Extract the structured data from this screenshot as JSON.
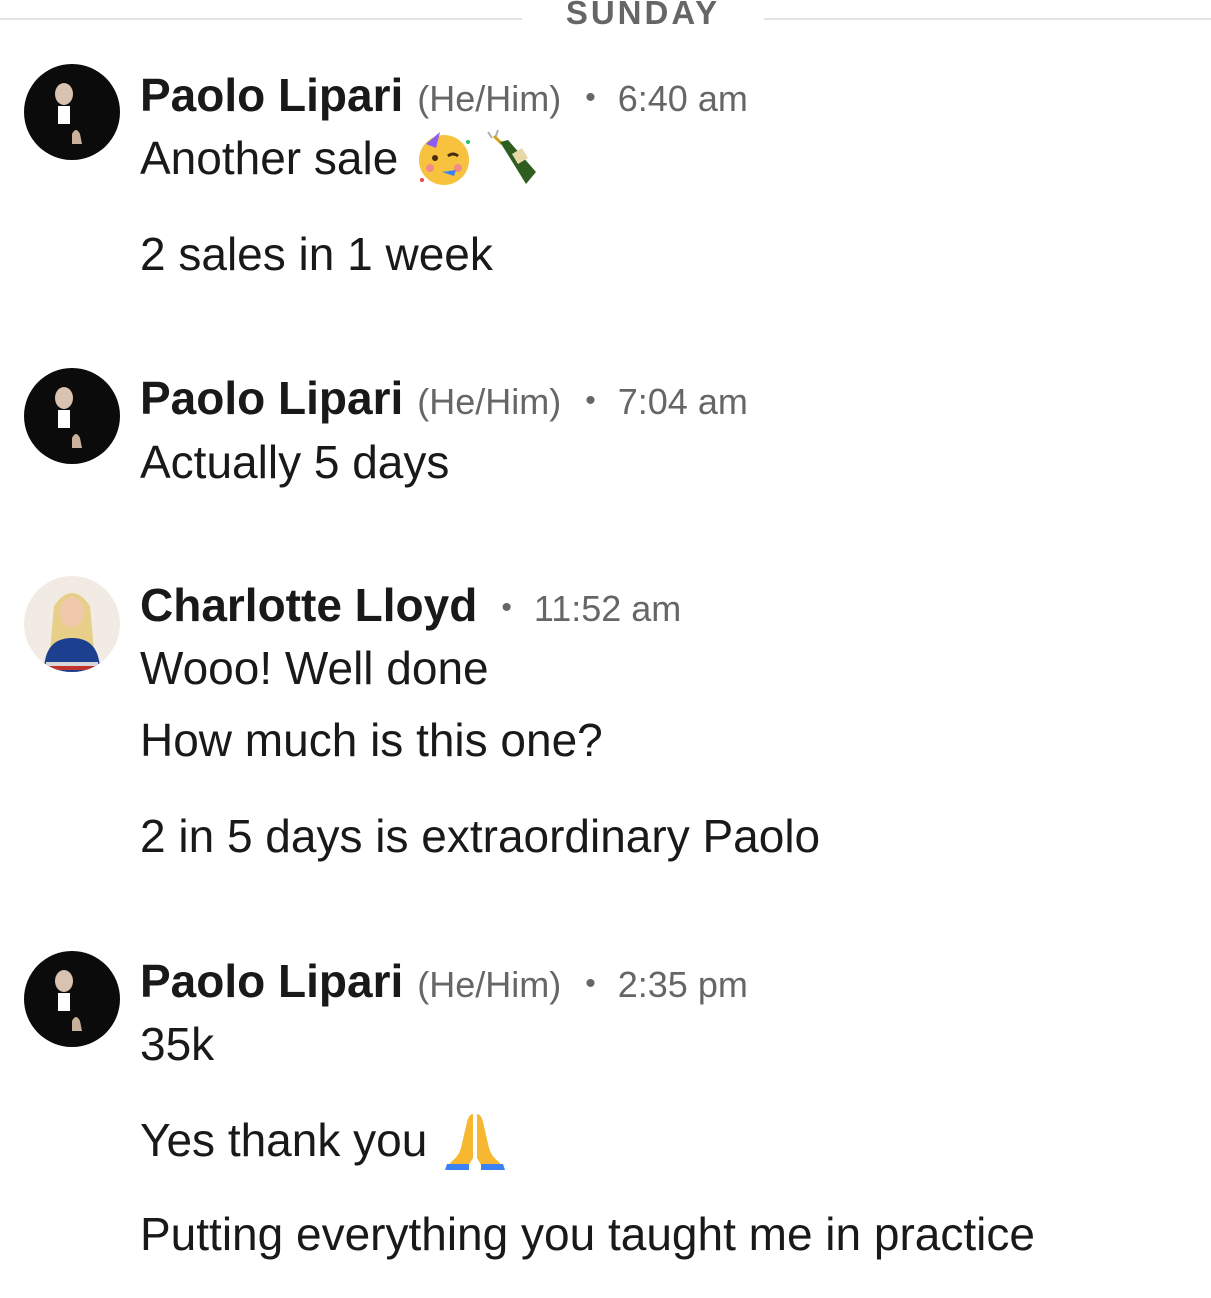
{
  "divider": {
    "label": "SUNDAY"
  },
  "groups": [
    {
      "name": "Paolo Lipari",
      "pronouns": "(He/Him)",
      "time": "6:40 am",
      "lines": [
        "Another sale",
        "2 sales in 1 week"
      ],
      "emojis": [
        "partying-face-emoji",
        "champagne-bottle-emoji"
      ]
    },
    {
      "name": "Paolo Lipari",
      "pronouns": "(He/Him)",
      "time": "7:04 am",
      "lines": [
        "Actually 5 days"
      ]
    },
    {
      "name": "Charlotte Lloyd",
      "time": "11:52 am",
      "lines": [
        "Wooo! Well done",
        "How much is this one?",
        "2 in 5 days is extraordinary Paolo"
      ]
    },
    {
      "name": "Paolo Lipari",
      "pronouns": "(He/Him)",
      "time": "2:35 pm",
      "lines": [
        "35k",
        "Yes thank you",
        "Putting everything you taught me in practice"
      ],
      "emojis": [
        "folded-hands-emoji"
      ]
    }
  ],
  "separator": "•"
}
